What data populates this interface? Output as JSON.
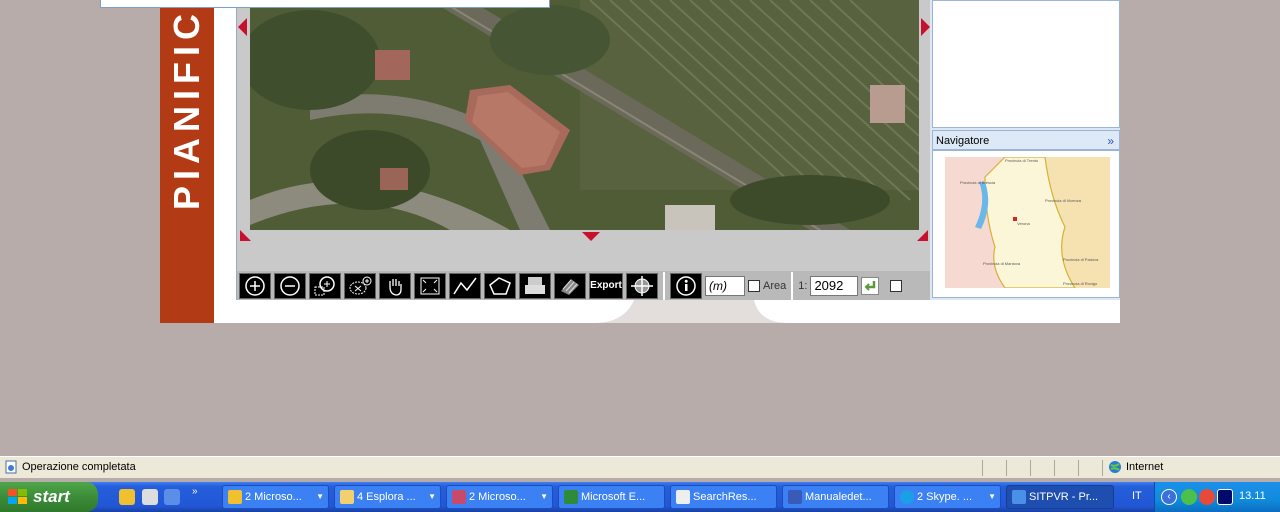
{
  "sidebar": {
    "vertical_text": "PIANIFICA"
  },
  "toolbar": {
    "export_label": "Export",
    "unit_value": "(m)",
    "area_label": "Area",
    "scale_prefix": "1:",
    "scale_value": "2092"
  },
  "navigator": {
    "title": "Navigatore",
    "map_labels": [
      "Provincia di Trento",
      "Provincia di Brescia",
      "Provincia di Vicenza",
      "Verona",
      "Provincia di Mantova",
      "Provincia di Padova",
      "Provincia di Rovigo"
    ]
  },
  "statusbar": {
    "message": "Operazione completata",
    "zone": "Internet"
  },
  "taskbar": {
    "start_label": "start",
    "buttons": [
      {
        "label": "2 Microso...",
        "icon": "outlook-icon"
      },
      {
        "label": "4 Esplora ...",
        "icon": "folder-icon"
      },
      {
        "label": "2 Microso...",
        "icon": "access-icon"
      },
      {
        "label": "Microsoft E...",
        "icon": "excel-icon"
      },
      {
        "label": "SearchRes...",
        "icon": "document-icon"
      },
      {
        "label": "Manualedet...",
        "icon": "word-icon"
      },
      {
        "label": "2 Skype. ...",
        "icon": "skype-icon"
      },
      {
        "label": "SITPVR - Pr...",
        "icon": "ie-icon"
      }
    ],
    "language": "IT",
    "clock": "13.11"
  },
  "colors": {
    "sidebar_red": "#b23a14",
    "panel_blue": "#99b6d9",
    "taskbar_blue": "#245edb"
  }
}
